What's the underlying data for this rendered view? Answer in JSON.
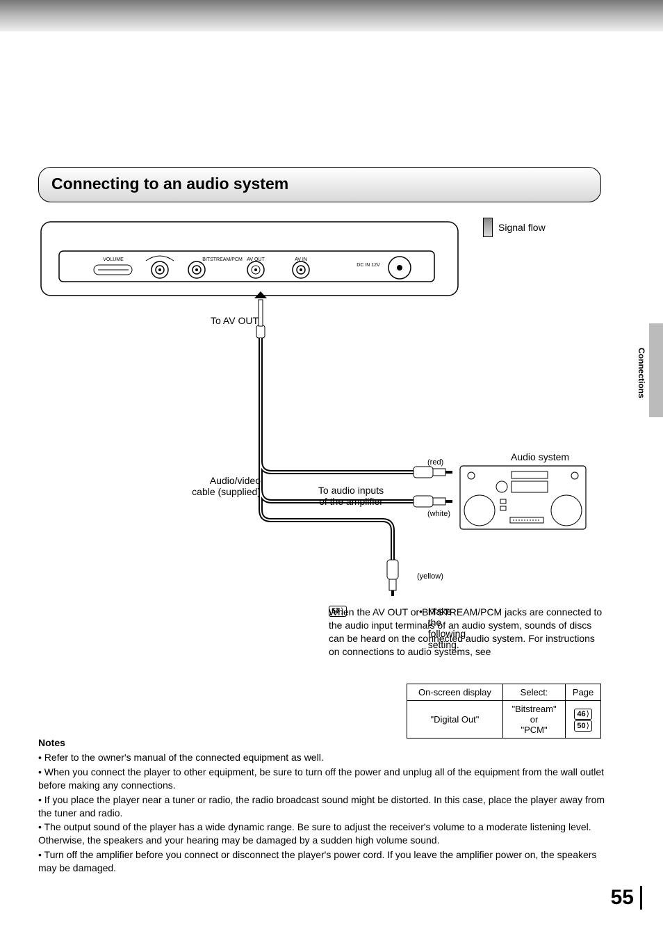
{
  "sideTab": "Connections",
  "pageNumber": "55",
  "title": "Connecting to an audio system",
  "signalFlow": "Signal flow",
  "device": {
    "volume": "VOLUME",
    "bitstream": "BITSTREAM/PCM",
    "avout": "AV OUT",
    "avin": "AV IN",
    "dcin": "DC IN 12V"
  },
  "labels": {
    "toAvOut": "To  AV OUT",
    "cable": "Audio/video\ncable (supplied)",
    "toInputs": "To audio inputs\nof the amplifier",
    "red": "(red)",
    "white": "(white)",
    "yellow": "(yellow)",
    "audioSystem": "Audio system"
  },
  "paragraph": "When the AV OUT or BITSTREAM/PCM jacks are connected to the audio input terminals of an audio system, sounds of discs can be heard on the connected audio system.  For instructions on connections to audio systems, see ",
  "paragraphRef": "57",
  "afterRef": ".",
  "settingLine": "Make the following setting.",
  "table": {
    "h1": "On-screen display",
    "h2": "Select:",
    "h3": "Page",
    "r1c1": "\"Digital Out\"",
    "r1c2": "\"Bitstream\"\nor\n\"PCM\"",
    "r1c3a": "46",
    "r1c3b": "50"
  },
  "notesHeading": "Notes",
  "notes": [
    "Refer to the owner's manual of the connected equipment as well.",
    "When you connect the player to other equipment, be sure to turn off the power and unplug all of the equipment from the wall outlet before making any connections.",
    "If you place the player near a tuner or radio, the radio broadcast sound might be distorted. In this case, place the player away from the tuner and radio.",
    "The output sound of the player has a wide dynamic range. Be sure to adjust the receiver's volume to a moderate listening level. Otherwise, the speakers and your hearing may be damaged by a sudden high volume sound.",
    "Turn off the amplifier before you connect or disconnect the player's power cord. If you leave the amplifier power on, the speakers may be damaged."
  ]
}
